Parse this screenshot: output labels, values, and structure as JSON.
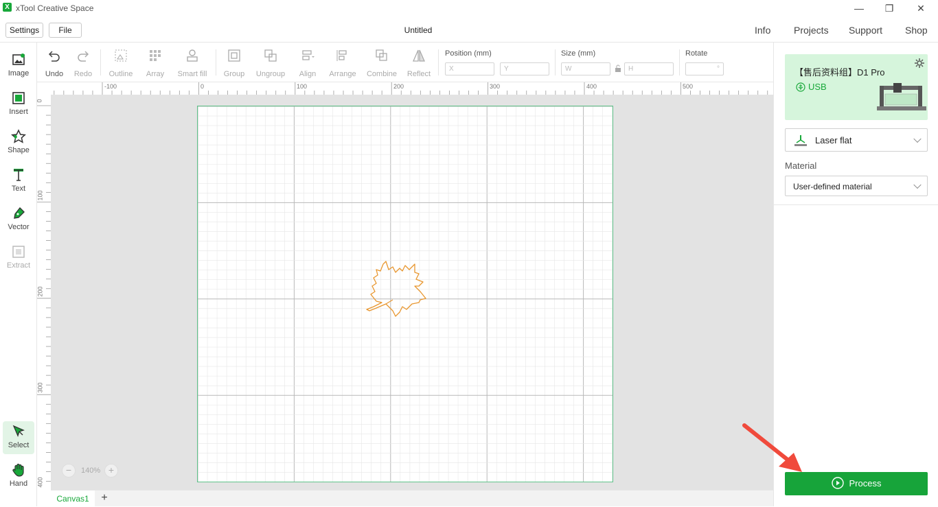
{
  "app": {
    "title": "xTool Creative Space",
    "logo_glyph": "X"
  },
  "window": {
    "minimize": "—",
    "restore": "❐",
    "close": "✕"
  },
  "menu": {
    "settings": "Settings",
    "file": "File",
    "document_title": "Untitled"
  },
  "top_links": {
    "info": "Info",
    "projects": "Projects",
    "support": "Support",
    "shop": "Shop"
  },
  "left_tools": {
    "image": "Image",
    "insert": "Insert",
    "shape": "Shape",
    "text": "Text",
    "vector": "Vector",
    "extract": "Extract",
    "select": "Select",
    "hand": "Hand"
  },
  "toolbar": {
    "undo": "Undo",
    "redo": "Redo",
    "outline": "Outline",
    "array": "Array",
    "smart_fill": "Smart fill",
    "group": "Group",
    "ungroup": "Ungroup",
    "align": "Align",
    "arrange": "Arrange",
    "combine": "Combine",
    "reflect": "Reflect",
    "position_label": "Position (mm)",
    "x_placeholder": "X",
    "y_placeholder": "Y",
    "size_label": "Size (mm)",
    "w_placeholder": "W",
    "h_placeholder": "H",
    "rotate_label": "Rotate",
    "rotate_unit": "°"
  },
  "ruler": {
    "top_labels": [
      "-100",
      "0",
      "100",
      "200",
      "300",
      "400",
      "500"
    ],
    "left_labels": [
      "0",
      "100",
      "200",
      "300",
      "400"
    ]
  },
  "canvas": {
    "zoom": "140%",
    "zoom_minus": "−",
    "zoom_plus": "+",
    "tab_name": "Canvas1",
    "add_tab": "+"
  },
  "device": {
    "name": "【售后资料组】D1 Pro",
    "connection": "USB"
  },
  "mode": {
    "selected": "Laser flat"
  },
  "material": {
    "label": "Material",
    "selected": "User-defined material"
  },
  "process": {
    "label": "Process"
  },
  "colors": {
    "accent": "#17a43a",
    "device_bg": "#d6f5dc",
    "design_stroke": "#e8962e",
    "workarea_border": "#5fc38a",
    "annotation_arrow": "#f04a3c"
  }
}
